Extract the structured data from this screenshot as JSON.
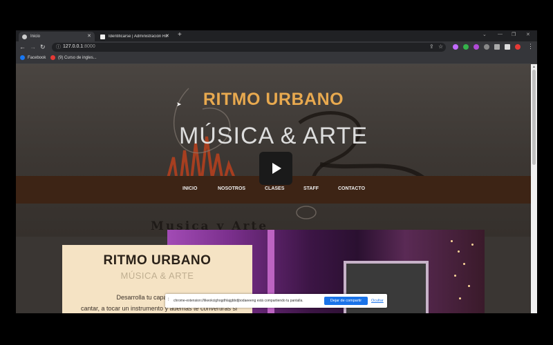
{
  "browser": {
    "tabs": [
      {
        "title": "Inicio",
        "active": true
      },
      {
        "title": "Identificarse | Administración Rit",
        "active": false
      }
    ],
    "new_tab_label": "+",
    "window_controls": {
      "minimize": "—",
      "restore": "❐",
      "close": "✕"
    },
    "nav": {
      "back": "←",
      "forward": "→",
      "reload": "↻"
    },
    "url_host": "127.0.0.1",
    "url_port": ":8000",
    "bookmarks": [
      {
        "label": "Facebook",
        "color": "#1877f2"
      },
      {
        "label": "(9) Curso de ingles...",
        "color": "#e53935"
      }
    ]
  },
  "hero": {
    "title": "RITMO URBANO",
    "subtitle": "MÚSICA & ARTE",
    "background_text": "Musica y Arte"
  },
  "nav": {
    "items": [
      "INICIO",
      "NOSOTROS",
      "CLASES",
      "STAFF",
      "CONTACTO"
    ]
  },
  "card": {
    "title": "RITMO URBANO",
    "subtitle": "MÚSICA & ARTE",
    "text_line1": "Desarrolla tu capacidad artistic",
    "text_line2": "cantar, a tocar un instrumento y además te convertiras si"
  },
  "share_bar": {
    "text": "chrome-extension://likeokcighogdhlajgbbdjbodaeeeng está compartiendo tu pantalla.",
    "stop_label": "Dejar de compartir",
    "hide_label": "Ocultar"
  },
  "colors": {
    "accent": "#e8a94f",
    "nav_bg": "#3d2415",
    "card_bg": "#f5e3c4",
    "share_button": "#1a73e8"
  }
}
